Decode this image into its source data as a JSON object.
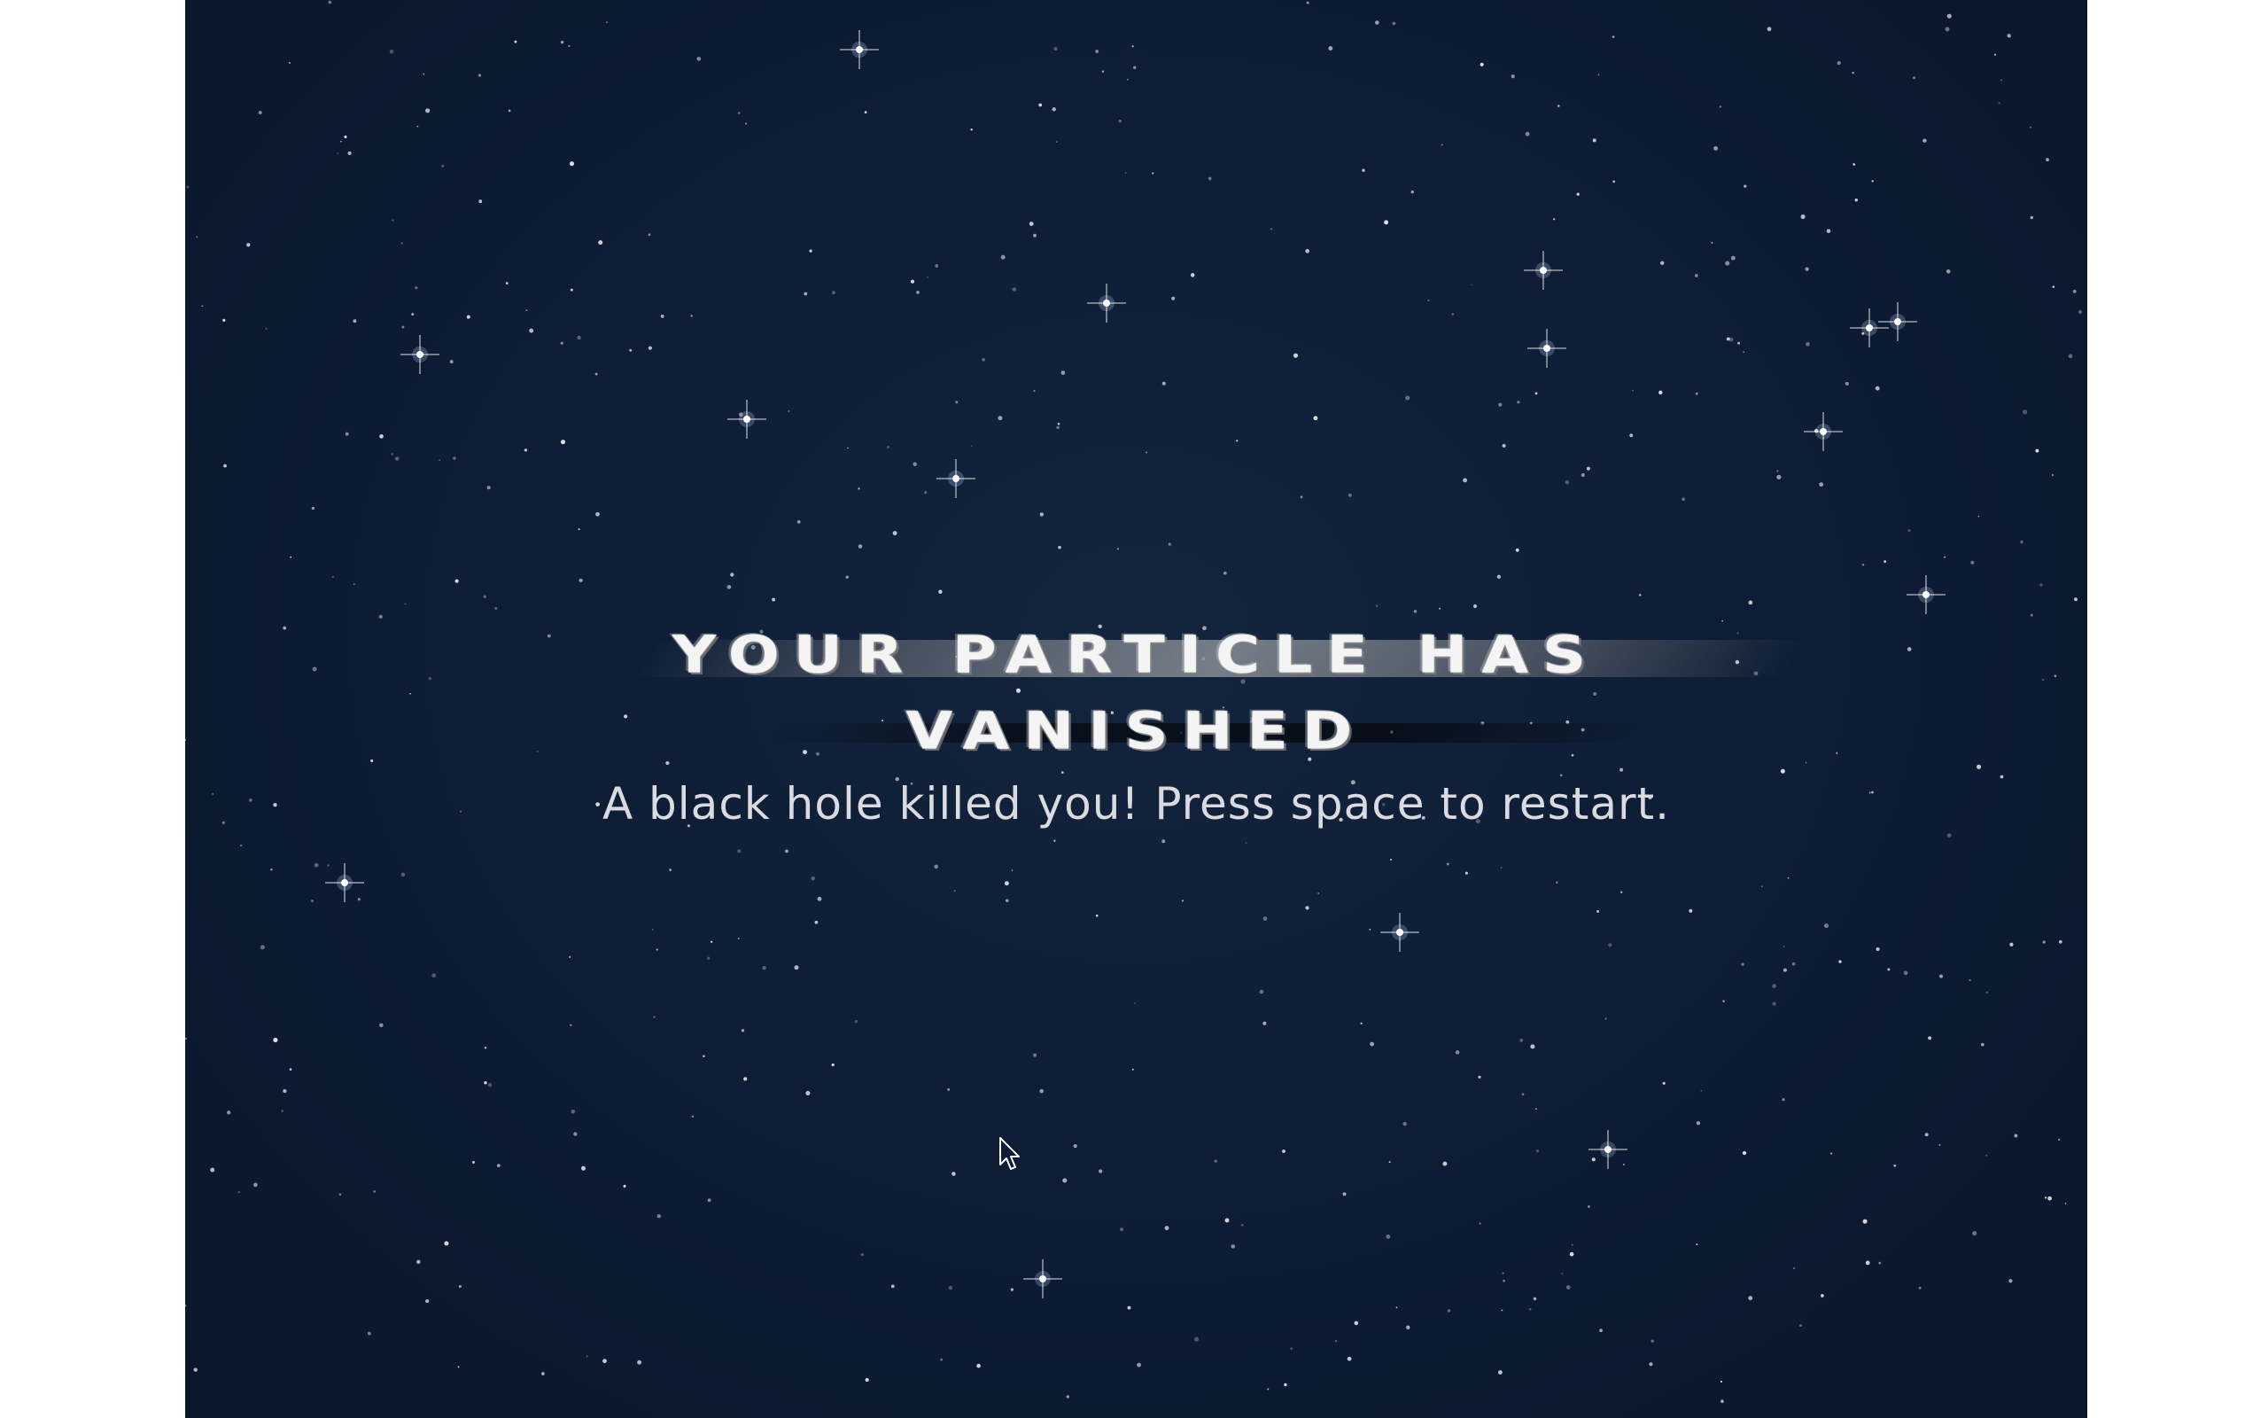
{
  "game_over": {
    "title_line_1": "YOUR PARTICLE HAS",
    "title_line_2": "VANISHED",
    "message": "A black hole killed you! Press space to restart."
  },
  "colors": {
    "space_background": "#0e1d35",
    "page_margin": "#ffffff",
    "title_text": "#f4f4f4",
    "message_text": "#d9dbe0",
    "star": "#ffffff"
  },
  "icons": {
    "cursor": "mouse-pointer-icon"
  }
}
